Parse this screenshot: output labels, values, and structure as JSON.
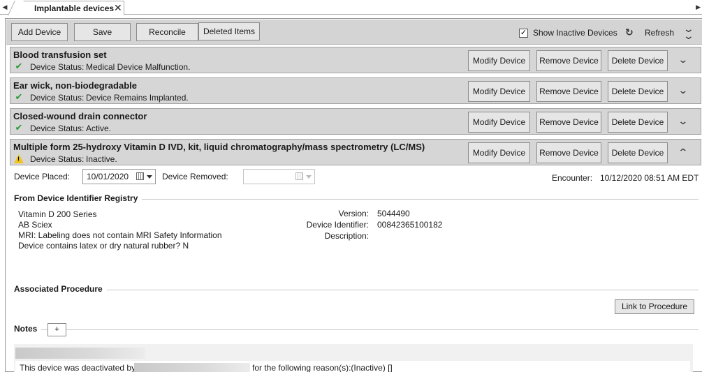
{
  "tab": {
    "label": "Implantable devices"
  },
  "toolbar": {
    "add_device": "Add Device",
    "save": "Save",
    "reconcile": "Reconcile",
    "deleted_items": "Deleted Items",
    "show_inactive_label": "Show Inactive Devices",
    "show_inactive_checked": true,
    "refresh": "Refresh"
  },
  "device_status_label": "Device Status:",
  "row_buttons": {
    "modify": "Modify Device",
    "remove": "Remove Device",
    "delete": "Delete Device"
  },
  "devices": [
    {
      "name": "Blood transfusion set",
      "status": "Medical Device Malfunction.",
      "status_icon": "check-icon",
      "expanded": false
    },
    {
      "name": "Ear wick, non-biodegradable",
      "status": "Device Remains Implanted.",
      "status_icon": "check-icon",
      "expanded": false
    },
    {
      "name": "Closed-wound drain connector",
      "status": "Active.",
      "status_icon": "check-icon",
      "expanded": false
    },
    {
      "name": "Multiple form 25-hydroxy Vitamin D IVD, kit, liquid chromatography/mass spectrometry (LC/MS)",
      "status": "Inactive.",
      "status_icon": "warning-icon",
      "expanded": true
    }
  ],
  "details": {
    "device_placed_label": "Device Placed:",
    "device_placed_value": "10/01/2020",
    "device_removed_label": "Device Removed:",
    "device_removed_value": "",
    "encounter_label": "Encounter:",
    "encounter_value": "10/12/2020 08:51 AM EDT",
    "registry_title": "From Device Identifier Registry",
    "registry_lines": [
      "Vitamin D 200 Series",
      "AB Sciex",
      "MRI:  Labeling does not contain MRI Safety Information",
      "Device contains latex or dry natural rubber?  N"
    ],
    "version_label": "Version:",
    "version_value": "5044490",
    "device_identifier_label": "Device Identifier:",
    "device_identifier_value": "00842365100182",
    "description_label": "Description:",
    "description_value": "",
    "associated_procedure_title": "Associated Procedure",
    "link_to_procedure": "Link to Procedure",
    "notes_title": "Notes",
    "notes_add": "+",
    "note_prefix": "This device was deactivated by",
    "note_suffix": "for the following reason(s):(Inactive) []"
  },
  "colors": {
    "toolbar_bg": "#d4d4d4",
    "row_bg": "#d6d6d6",
    "button_bg": "#e6e6e6",
    "check_green": "#2e9a3a",
    "warning_yellow": "#f2c51d"
  }
}
